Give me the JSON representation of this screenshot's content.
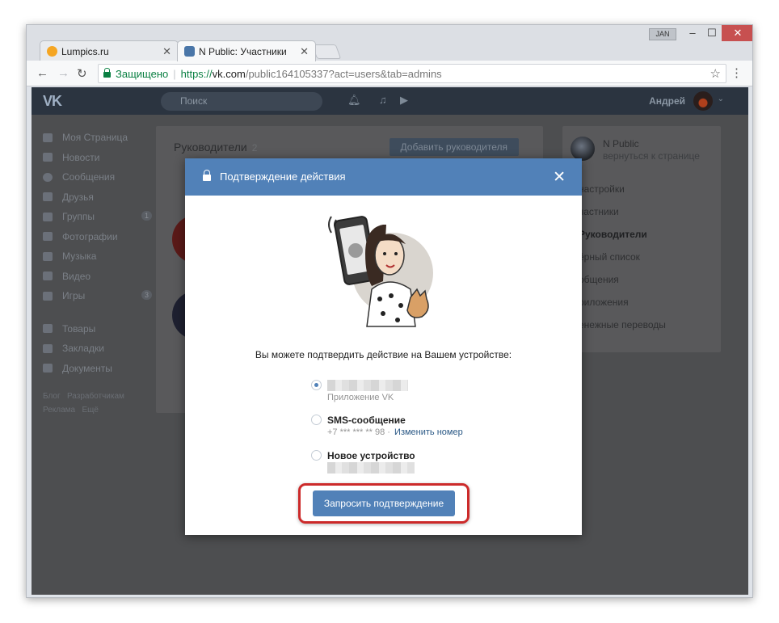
{
  "browser": {
    "tabs": [
      {
        "label": "Lumpics.ru",
        "favicon_color": "#f5a623"
      },
      {
        "label": "N Public: Участники",
        "favicon_color": "#4a76a8"
      }
    ],
    "window_user_badge": "JAN",
    "window_buttons": {
      "minimize": "–",
      "maximize": "☐",
      "close": "✕"
    },
    "address": {
      "secure_label": "Защищено",
      "url_scheme": "https://",
      "url_host": "vk.com",
      "url_path": "/public164105337?act=users&tab=admins"
    }
  },
  "vk": {
    "logo": "VK",
    "search_placeholder": "Поиск",
    "user_name": "Андрей",
    "left_nav": [
      {
        "label": "Моя Страница"
      },
      {
        "label": "Новости"
      },
      {
        "label": "Сообщения"
      },
      {
        "label": "Друзья"
      },
      {
        "label": "Группы",
        "count": "1"
      },
      {
        "label": "Фотографии"
      },
      {
        "label": "Музыка"
      },
      {
        "label": "Видео"
      },
      {
        "label": "Игры",
        "count": "3"
      }
    ],
    "left_nav_2": [
      {
        "label": "Товары"
      },
      {
        "label": "Закладки"
      },
      {
        "label": "Документы"
      }
    ],
    "footer_links": [
      "Блог",
      "Разработчикам",
      "Реклама",
      "Ещё"
    ],
    "content": {
      "title": "Руководители",
      "count": "2",
      "add_button": "Добавить руководителя"
    },
    "right_menu": {
      "name": "N Public",
      "back": "вернуться к странице",
      "items": [
        {
          "label": "настройки",
          "bold": false
        },
        {
          "label": "частники",
          "bold": false
        },
        {
          "label": "Руководители",
          "bold": true
        },
        {
          "label": "ёрный список",
          "bold": false
        },
        {
          "label": "общения",
          "bold": false
        },
        {
          "label": "риложения",
          "bold": false
        },
        {
          "label": "енежные переводы",
          "bold": false
        }
      ]
    }
  },
  "modal": {
    "title": "Подтверждение действия",
    "close": "✕",
    "question": "Вы можете подтвердить действие на Вашем устройстве:",
    "options": [
      {
        "title": "",
        "subtitle": "Приложение VK",
        "checked": true
      },
      {
        "title": "SMS-сообщение",
        "subtitle": "+7 *** *** ** 98 ·",
        "link": "Изменить номер",
        "checked": false
      },
      {
        "title": "Новое устройство",
        "subtitle": "",
        "checked": false
      }
    ],
    "request_button": "Запросить подтверждение"
  },
  "colors": {
    "vk_blue": "#5181b8",
    "highlight_red": "#cc2a2a"
  }
}
